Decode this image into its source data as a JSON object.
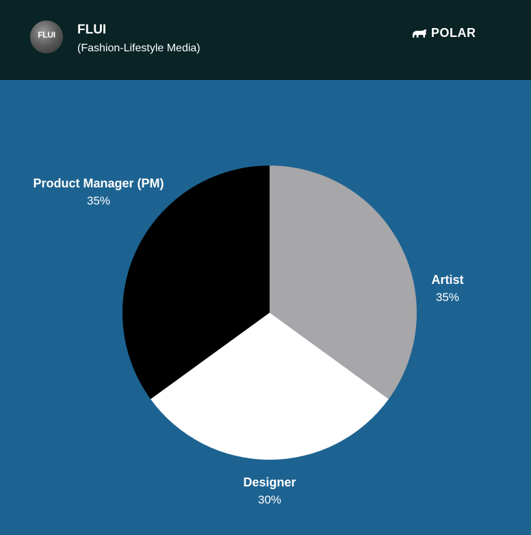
{
  "header": {
    "avatar_text": "FLUI",
    "title": "FLUI",
    "subtitle": "(Fashion-Lifestyle Media)",
    "brand": "POLAR",
    "brand_icon": "bear-icon"
  },
  "colors": {
    "header_bg": "#0a2426",
    "chart_bg": "#1d6391"
  },
  "chart_data": {
    "type": "pie",
    "title": "",
    "categories": [
      "Artist",
      "Designer",
      "Product Manager (PM)"
    ],
    "values": [
      35,
      30,
      35
    ],
    "labels": [
      "35%",
      "30%",
      "35%"
    ],
    "colors": [
      "#a7a6a9",
      "#ffffff",
      "#000000"
    ],
    "start": "top",
    "direction": "clockwise"
  }
}
